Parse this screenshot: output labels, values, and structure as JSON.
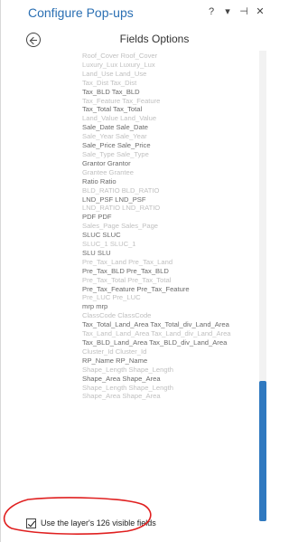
{
  "window": {
    "title": "Configure Pop-ups",
    "controls": [
      "?",
      "▾",
      "⊣",
      "✕"
    ]
  },
  "panel": {
    "heading": "Fields Options"
  },
  "fields": [
    {
      "label": "Roof_Cover Roof_Cover",
      "tone": "dim"
    },
    {
      "label": "Luxury_Lux Luxury_Lux",
      "tone": "dim"
    },
    {
      "label": "Land_Use Land_Use",
      "tone": "dim"
    },
    {
      "label": "Tax_Dist Tax_Dist",
      "tone": "dim"
    },
    {
      "label": "Tax_BLD Tax_BLD",
      "tone": "mid"
    },
    {
      "label": "Tax_Feature Tax_Feature",
      "tone": "dim"
    },
    {
      "label": "Tax_Total Tax_Total",
      "tone": "mid"
    },
    {
      "label": "Land_Value Land_Value",
      "tone": "dim"
    },
    {
      "label": "Sale_Date Sale_Date",
      "tone": "mid"
    },
    {
      "label": "Sale_Year Sale_Year",
      "tone": "dim"
    },
    {
      "label": "Sale_Price Sale_Price",
      "tone": "mid"
    },
    {
      "label": "Sale_Type Sale_Type",
      "tone": "dim"
    },
    {
      "label": "Grantor Grantor",
      "tone": "mid"
    },
    {
      "label": "Grantee Grantee",
      "tone": "dim"
    },
    {
      "label": "Ratio Ratio",
      "tone": "mid"
    },
    {
      "label": "BLD_RATIO BLD_RATIO",
      "tone": "dim"
    },
    {
      "label": "LND_PSF LND_PSF",
      "tone": "mid"
    },
    {
      "label": "LND_RATIO LND_RATIO",
      "tone": "dim"
    },
    {
      "label": "PDF PDF",
      "tone": "mid"
    },
    {
      "label": "Sales_Page Sales_Page",
      "tone": "dim"
    },
    {
      "label": "SLUC SLUC",
      "tone": "mid"
    },
    {
      "label": "SLUC_1 SLUC_1",
      "tone": "dim"
    },
    {
      "label": "SLU SLU",
      "tone": "mid"
    },
    {
      "label": "Pre_Tax_Land Pre_Tax_Land",
      "tone": "dim"
    },
    {
      "label": "Pre_Tax_BLD Pre_Tax_BLD",
      "tone": "mid"
    },
    {
      "label": "Pre_Tax_Total Pre_Tax_Total",
      "tone": "dim"
    },
    {
      "label": "Pre_Tax_Feature Pre_Tax_Feature",
      "tone": "mid"
    },
    {
      "label": "Pre_LUC Pre_LUC",
      "tone": "dim"
    },
    {
      "label": "mrp mrp",
      "tone": "mid"
    },
    {
      "label": "ClassCode ClassCode",
      "tone": "dim"
    },
    {
      "label": "Tax_Total_Land_Area Tax_Total_div_Land_Area",
      "tone": "mid"
    },
    {
      "label": "Tax_Land_Land_Area Tax_Land_div_Land_Area",
      "tone": "dim"
    },
    {
      "label": "Tax_BLD_Land_Area Tax_BLD_div_Land_Area",
      "tone": "mid"
    },
    {
      "label": "Cluster_Id Cluster_Id",
      "tone": "dim"
    },
    {
      "label": "RP_Name RP_Name",
      "tone": "mid"
    },
    {
      "label": "Shape_Length Shape_Length",
      "tone": "dim"
    },
    {
      "label": "Shape_Area Shape_Area",
      "tone": "mid"
    },
    {
      "label": "Shape_Length Shape_Length",
      "tone": "dim"
    },
    {
      "label": "Shape_Area Shape_Area",
      "tone": "dim"
    }
  ],
  "footer": {
    "checkbox_checked": true,
    "label": "Use the layer's 126 visible fields"
  },
  "colors": {
    "title": "#2a6fb3",
    "scroll_thumb": "#2f79c0",
    "annotation": "#e02020"
  }
}
